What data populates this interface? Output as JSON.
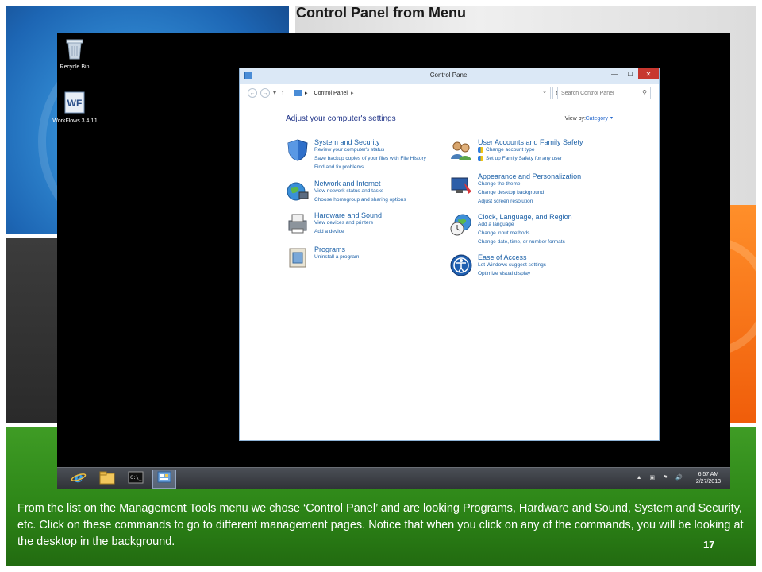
{
  "slide": {
    "title": "Control Panel from Menu",
    "caption": "From the list on the Management Tools menu we chose ‘Control Panel’ and are looking Programs, Hardware and Sound, System and Security, etc. Click on these commands to go to different management pages. Notice that when you click on any of the commands, you will be looking at the desktop in the background.",
    "page_number": "17"
  },
  "desktop": {
    "icons": [
      {
        "label": "Recycle Bin",
        "icon": "recycle-bin-icon"
      },
      {
        "label": "WorkFlows 3.4.1J",
        "icon": "workflows-icon"
      }
    ],
    "taskbar": {
      "buttons": [
        {
          "name": "internet-explorer",
          "icon": "ie-icon"
        },
        {
          "name": "file-explorer",
          "icon": "folder-icon"
        },
        {
          "name": "command-prompt",
          "icon": "cmd-icon"
        },
        {
          "name": "control-panel",
          "icon": "control-panel-icon",
          "active": true
        }
      ],
      "tray_icons": "▲ ▣ ⚑ 🔊",
      "time": "6:57 AM",
      "date": "2/27/2013"
    }
  },
  "window": {
    "title": "Control Panel",
    "min_symbol": "—",
    "max_symbol": "☐",
    "close_symbol": "✕",
    "nav": {
      "back": "←",
      "forward": "→",
      "recent": "▾",
      "up": "↑"
    },
    "address": {
      "root_sep": "▸",
      "location": "Control Panel",
      "end_sep": "▸",
      "dropdown": "⌄"
    },
    "refresh": "↻",
    "search_placeholder": "Search Control Panel",
    "search_icon": "⚲",
    "heading": "Adjust your computer's settings",
    "view_by_label": "View by:",
    "view_by_value": "Category",
    "view_by_arrow": "▾",
    "categories_left": [
      {
        "title": "System and Security",
        "icon": "shield-icon",
        "links": [
          "Review your computer's status",
          "Save backup copies of your files with File History",
          "Find and fix problems"
        ]
      },
      {
        "title": "Network and Internet",
        "icon": "network-globe-icon",
        "links": [
          "View network status and tasks",
          "Choose homegroup and sharing options"
        ]
      },
      {
        "title": "Hardware and Sound",
        "icon": "printer-icon",
        "links": [
          "View devices and printers",
          "Add a device"
        ]
      },
      {
        "title": "Programs",
        "icon": "programs-icon",
        "links": [
          "Uninstall a program"
        ]
      }
    ],
    "categories_right": [
      {
        "title": "User Accounts and Family Safety",
        "icon": "users-icon",
        "links": [
          "Change account type",
          "Set up Family Safety for any user"
        ]
      },
      {
        "title": "Appearance and Personalization",
        "icon": "monitor-paint-icon",
        "links": [
          "Change the theme",
          "Change desktop background",
          "Adjust screen resolution"
        ]
      },
      {
        "title": "Clock, Language, and Region",
        "icon": "clock-globe-icon",
        "links": [
          "Add a language",
          "Change input methods",
          "Change date, time, or number formats"
        ]
      },
      {
        "title": "Ease of Access",
        "icon": "ease-of-access-icon",
        "links": [
          "Let Windows suggest settings",
          "Optimize visual display"
        ]
      }
    ]
  }
}
